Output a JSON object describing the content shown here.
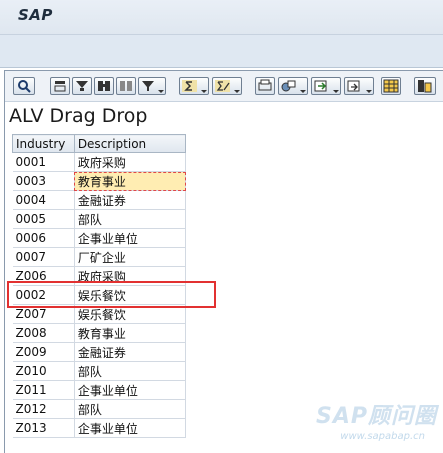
{
  "header": {
    "logo": "SAP"
  },
  "alv": {
    "title": "ALV Drag Drop"
  },
  "table": {
    "columns": [
      "Industry",
      "Description"
    ],
    "rows": [
      {
        "industry": "0001",
        "description": "政府采购"
      },
      {
        "industry": "0003",
        "description": "教育事业"
      },
      {
        "industry": "0004",
        "description": "金融证券"
      },
      {
        "industry": "0005",
        "description": "部队"
      },
      {
        "industry": "0006",
        "description": "企事业单位"
      },
      {
        "industry": "0007",
        "description": "厂矿企业"
      },
      {
        "industry": "Z006",
        "description": "政府采购"
      },
      {
        "industry": "0002",
        "description": "娱乐餐饮"
      },
      {
        "industry": "Z007",
        "description": "娱乐餐饮"
      },
      {
        "industry": "Z008",
        "description": "教育事业"
      },
      {
        "industry": "Z009",
        "description": "金融证券"
      },
      {
        "industry": "Z010",
        "description": "部队"
      },
      {
        "industry": "Z011",
        "description": "企事业单位"
      },
      {
        "industry": "Z012",
        "description": "部队"
      },
      {
        "industry": "Z013",
        "description": "企事业单位"
      }
    ]
  },
  "watermark": {
    "brand": "SAP顾问圈",
    "url": "www.sapabap.cn"
  }
}
